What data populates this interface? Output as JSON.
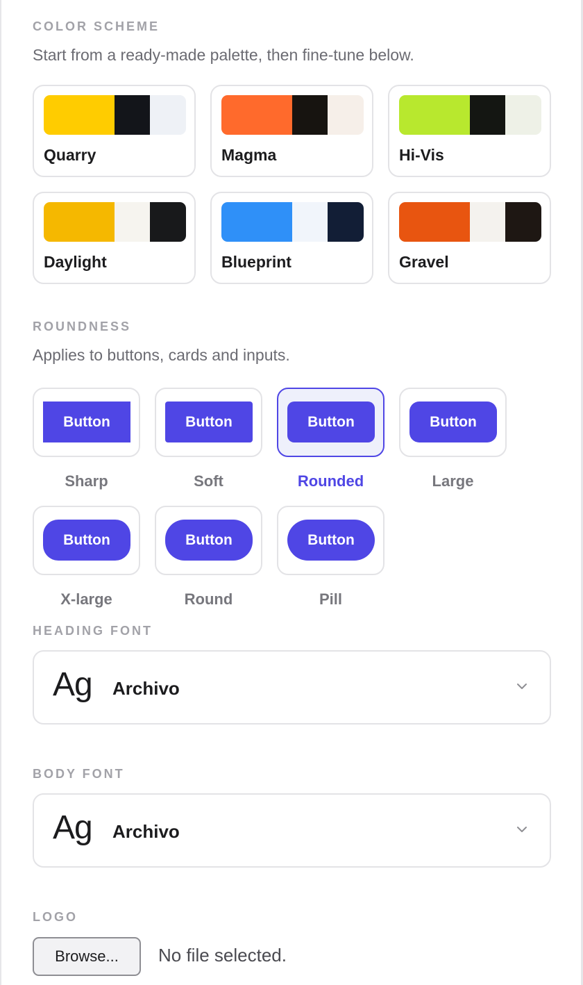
{
  "color_scheme": {
    "label": "COLOR SCHEME",
    "description": "Start from a ready-made palette, then fine-tune below.",
    "schemes": [
      {
        "name": "Quarry",
        "colors": [
          "#ffcc00",
          "#13151a",
          "#eef1f6"
        ]
      },
      {
        "name": "Magma",
        "colors": [
          "#ff6a2c",
          "#171410",
          "#f6efe9"
        ]
      },
      {
        "name": "Hi-Vis",
        "colors": [
          "#b8e82e",
          "#141612",
          "#eef1e7"
        ]
      },
      {
        "name": "Daylight",
        "colors": [
          "#f5b800",
          "#f6f4ef",
          "#18191b"
        ]
      },
      {
        "name": "Blueprint",
        "colors": [
          "#2f90f8",
          "#f1f5fb",
          "#121e36"
        ]
      },
      {
        "name": "Gravel",
        "colors": [
          "#e85510",
          "#f4f2ee",
          "#1e1713"
        ]
      }
    ]
  },
  "roundness": {
    "label": "ROUNDNESS",
    "description": "Applies to buttons, cards and inputs.",
    "button_text": "Button",
    "selected": "Rounded",
    "accent_color": "#4f46e5",
    "options": [
      {
        "label": "Sharp"
      },
      {
        "label": "Soft"
      },
      {
        "label": "Rounded"
      },
      {
        "label": "Large"
      },
      {
        "label": "X-large"
      },
      {
        "label": "Round"
      },
      {
        "label": "Pill"
      }
    ]
  },
  "heading_font": {
    "label": "HEADING FONT",
    "sample": "Ag",
    "value": "Archivo",
    "icon": "chevron-down-icon"
  },
  "body_font": {
    "label": "BODY FONT",
    "sample": "Ag",
    "value": "Archivo",
    "icon": "chevron-down-icon"
  },
  "logo": {
    "label": "LOGO",
    "browse_label": "Browse...",
    "status": "No file selected."
  }
}
